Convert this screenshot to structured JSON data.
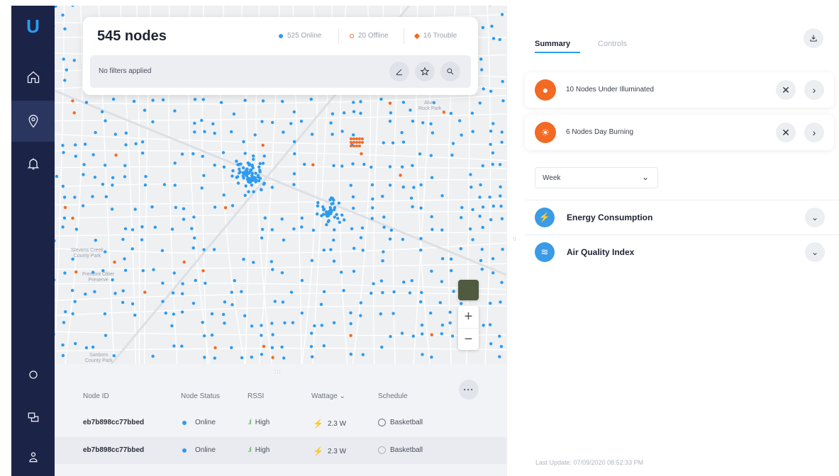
{
  "app": {
    "logo": "U"
  },
  "sidebar": {
    "items": [
      {
        "name": "home",
        "icon": "home-icon"
      },
      {
        "name": "map",
        "icon": "location-pin-icon",
        "active": true
      },
      {
        "name": "alerts",
        "icon": "bell-icon"
      },
      {
        "name": "settings",
        "icon": "circle-icon"
      },
      {
        "name": "devices",
        "icon": "devices-icon"
      },
      {
        "name": "user",
        "icon": "user-icon"
      }
    ]
  },
  "map": {
    "header": {
      "node_count": "545 nodes",
      "online": "525 Online",
      "offline": "20 Offline",
      "trouble": "16 Trouble",
      "online_color": "#2d9bf0",
      "offline_color": "#f26a23",
      "trouble_color": "#f26a23"
    },
    "filter": {
      "text": "No filters applied"
    },
    "labels": {
      "alum_rock": "Alum\nRock Park",
      "stevens_creek": "Stevens Creek\nCounty Park",
      "fremont": "Fremont Older\nPreserve",
      "sanborn": "Sanborn\nCounty Park"
    },
    "zoom_in": "+",
    "zoom_out": "−"
  },
  "table": {
    "drag_handle": ":::",
    "more": "···",
    "headers": {
      "node_id": "Node ID",
      "node_status": "Node Status",
      "rssi": "RSSI",
      "wattage": "Wattage",
      "schedule": "Schedule"
    },
    "rows": [
      {
        "node_id": "eb7b898cc77bbed",
        "status": "Online",
        "rssi": "High",
        "wattage": "2.3 W",
        "schedule": "Basketball"
      },
      {
        "node_id": "eb7b898cc77bbed",
        "status": "Online",
        "rssi": "High",
        "wattage": "2.3 W",
        "schedule": "Basketball"
      }
    ]
  },
  "panel": {
    "tabs": {
      "summary": "Summary",
      "controls": "Controls"
    },
    "alerts": [
      {
        "text": "10 Nodes Under Illuminated",
        "icon": "bulb-icon"
      },
      {
        "text": "6 Nodes Day Burning",
        "icon": "sun-icon"
      }
    ],
    "period": "Week",
    "sections": [
      {
        "title": "Energy Consumption",
        "icon": "bolt-icon"
      },
      {
        "title": "Air Quality Index",
        "icon": "wind-icon"
      }
    ],
    "last_update": "Last Update: 07/09/2020 08:52:33 PM"
  }
}
